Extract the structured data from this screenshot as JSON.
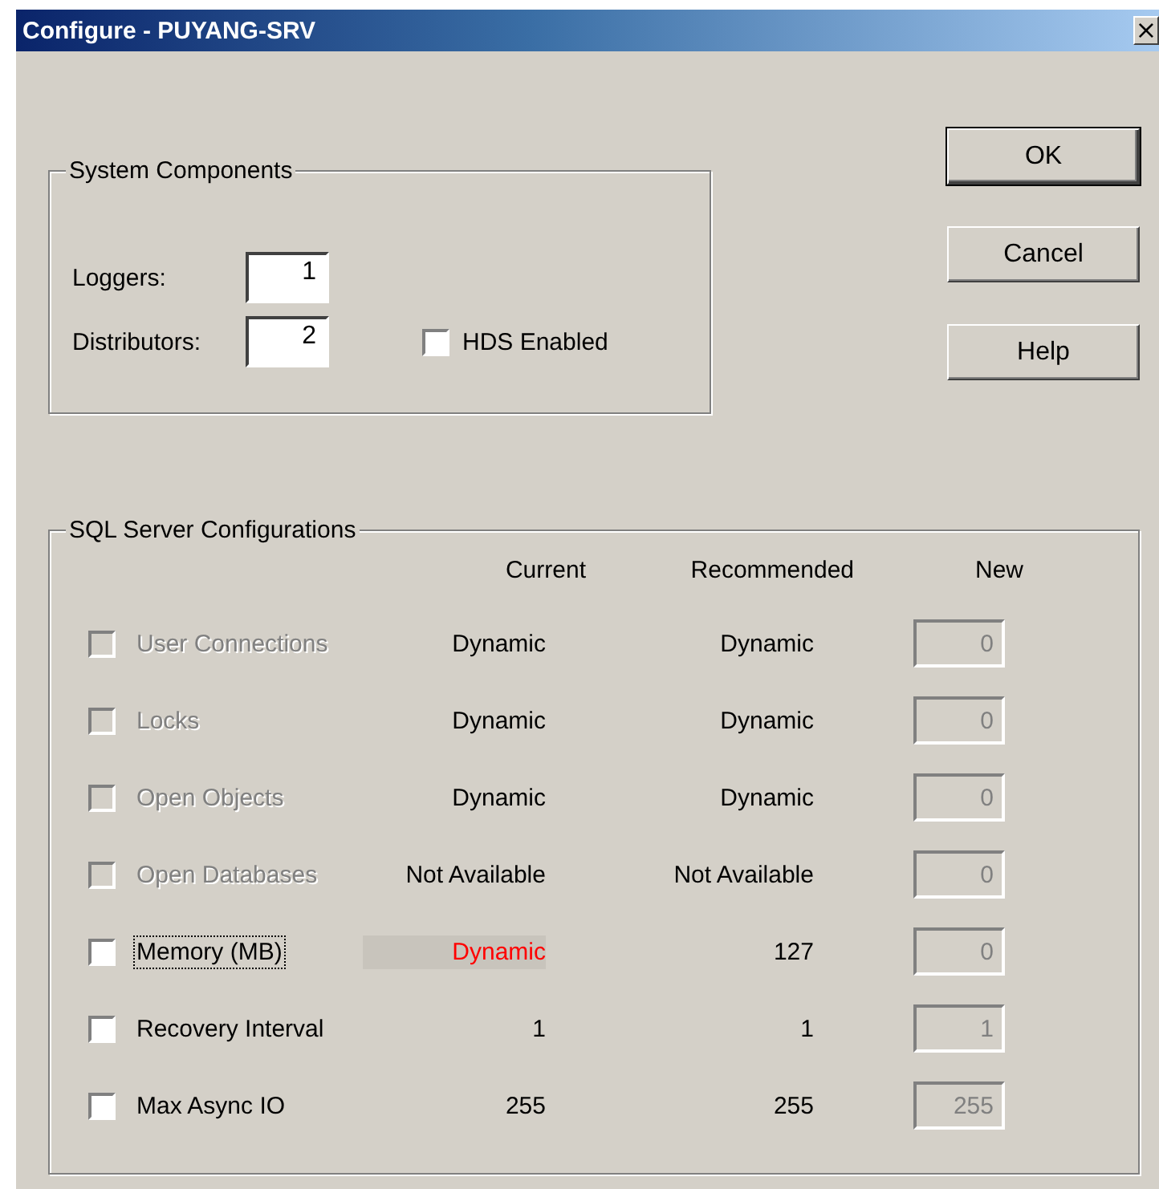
{
  "window": {
    "title": "Configure - PUYANG-SRV",
    "close": "×"
  },
  "system_components": {
    "title": "System Components",
    "loggers": {
      "label": "Loggers:",
      "value": "1"
    },
    "distributors": {
      "label": "Distributors:",
      "value": "2"
    },
    "hds_enabled": {
      "label": "HDS Enabled",
      "checked": false
    }
  },
  "buttons": [
    {
      "label": "OK",
      "default": true
    },
    {
      "label": "Cancel",
      "default": false
    },
    {
      "label": "Help",
      "default": false
    }
  ],
  "sql_server": {
    "title": "SQL Server Configurations",
    "columns": [
      "Current",
      "Recommended",
      "New"
    ],
    "rows": [
      {
        "name": "User Connections",
        "current": "Dynamic",
        "recommended": "Dynamic",
        "new": "0",
        "checked": false,
        "disabled": true,
        "focused": false,
        "current_highlighted": false,
        "new_disabled": true
      },
      {
        "name": "Locks",
        "current": "Dynamic",
        "recommended": "Dynamic",
        "new": "0",
        "checked": false,
        "disabled": true,
        "focused": false,
        "current_highlighted": false,
        "new_disabled": true
      },
      {
        "name": "Open Objects",
        "current": "Dynamic",
        "recommended": "Dynamic",
        "new": "0",
        "checked": false,
        "disabled": true,
        "focused": false,
        "current_highlighted": false,
        "new_disabled": true
      },
      {
        "name": "Open Databases",
        "current": "Not Available",
        "recommended": "Not Available",
        "new": "0",
        "checked": false,
        "disabled": true,
        "focused": false,
        "current_highlighted": false,
        "new_disabled": true
      },
      {
        "name": "Memory (MB)",
        "current": "Dynamic",
        "recommended": "127",
        "new": "0",
        "checked": false,
        "disabled": false,
        "focused": true,
        "current_highlighted": true,
        "new_disabled": true
      },
      {
        "name": "Recovery Interval",
        "current": "1",
        "recommended": "1",
        "new": "1",
        "checked": false,
        "disabled": false,
        "focused": false,
        "current_highlighted": false,
        "new_disabled": true
      },
      {
        "name": "Max Async IO",
        "current": "255",
        "recommended": "255",
        "new": "255",
        "checked": false,
        "disabled": false,
        "focused": false,
        "current_highlighted": false,
        "new_disabled": true
      }
    ]
  }
}
